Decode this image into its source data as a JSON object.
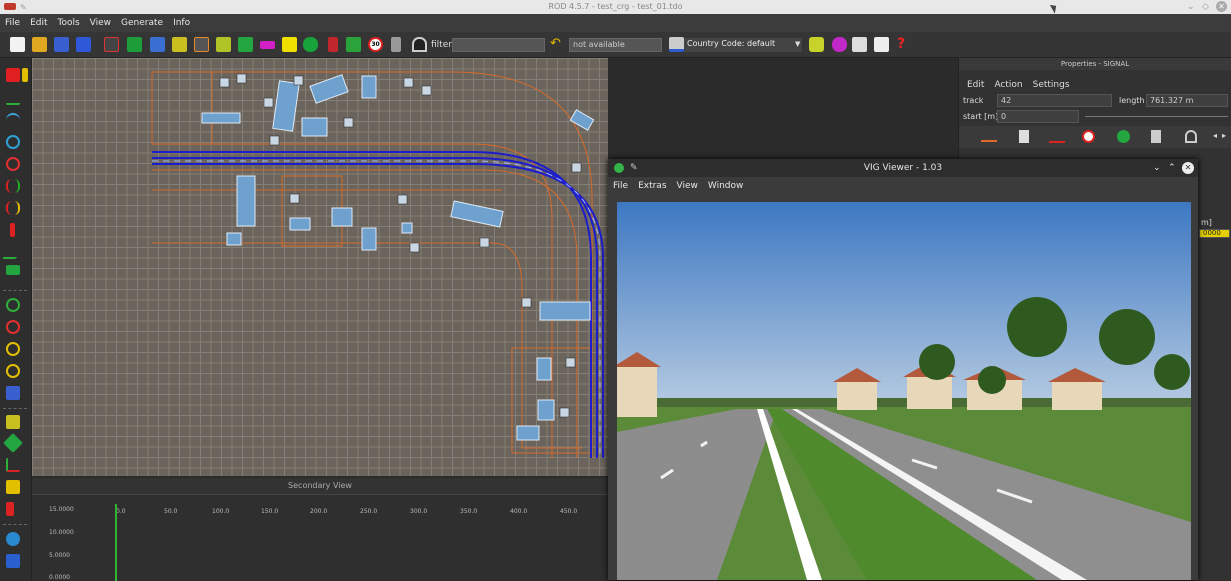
{
  "window": {
    "title": "ROD 4.5.7 - test_crg - test_01.tdo"
  },
  "menubar": {
    "items": [
      "File",
      "Edit",
      "Tools",
      "View",
      "Generate",
      "Info"
    ]
  },
  "toolbar": {
    "filter_label": "filter:",
    "filter_value": "",
    "status_value": "not available",
    "country_label": "Country Code: default"
  },
  "secondary_view": {
    "title": "Secondary View",
    "y_ticks": [
      "15.0000",
      "10.0000",
      "5.0000",
      "0.0000"
    ],
    "x_ticks": [
      "0.0",
      "50.0",
      "100.0",
      "150.0",
      "200.0",
      "250.0",
      "300.0",
      "350.0",
      "400.0",
      "450.0"
    ]
  },
  "properties": {
    "title": "Properties - SIGNAL",
    "menu": [
      "Edit",
      "Action",
      "Settings"
    ],
    "track_label": "track",
    "track_value": "42",
    "length_label": "length",
    "length_value": "761.327 m",
    "start_label": "start [m]",
    "start_value": "0",
    "side_fragment": "m]",
    "side_value": "0000"
  },
  "vig_viewer": {
    "title": "VIG Viewer - 1.03",
    "menu": [
      "File",
      "Extras",
      "View",
      "Window"
    ]
  },
  "colors": {
    "accent_yellow": "#e4d000",
    "road_blue": "#1d1dcc",
    "road_orange": "#d86a2a"
  }
}
